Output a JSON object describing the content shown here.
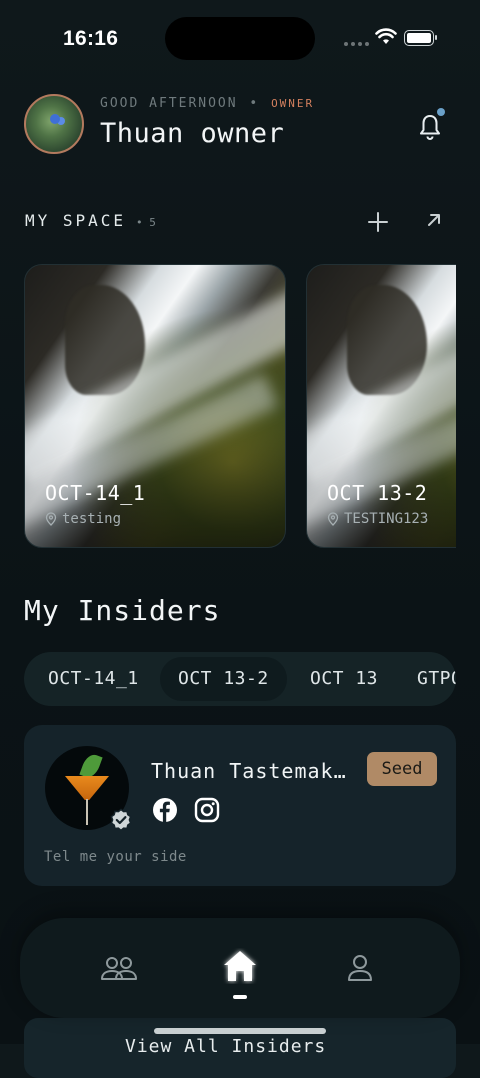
{
  "status_bar": {
    "time": "16:16"
  },
  "header": {
    "greeting": "GOOD AFTERNOON",
    "separator": "•",
    "role": "OWNER",
    "user_name": "Thuan owner",
    "notification_dot_color": "#6aa0c8"
  },
  "my_space": {
    "title": "MY SPACE",
    "count": "• 5",
    "cards": [
      {
        "title": "OCT-14_1",
        "location": "testing"
      },
      {
        "title": "OCT 13-2",
        "location": "TESTING123"
      }
    ]
  },
  "insiders": {
    "title": "My Insiders",
    "tabs": [
      "OCT-14_1",
      "OCT 13-2",
      "OCT 13",
      "GTPO"
    ],
    "active_tab": "OCT 13-2",
    "card": {
      "name": "Thuan Tastemak…",
      "badge": "Seed",
      "badge_color": "#b08a66",
      "description": "Tel me your side",
      "social_icons": [
        "facebook-icon",
        "instagram-icon"
      ]
    }
  },
  "bottom_nav": {
    "items": [
      "people-icon",
      "home-icon",
      "profile-icon"
    ],
    "active": "home-icon"
  },
  "peek_button": {
    "label": "View All Insiders"
  },
  "colors": {
    "background": "#0b1316",
    "accent": "#d27f5e"
  }
}
